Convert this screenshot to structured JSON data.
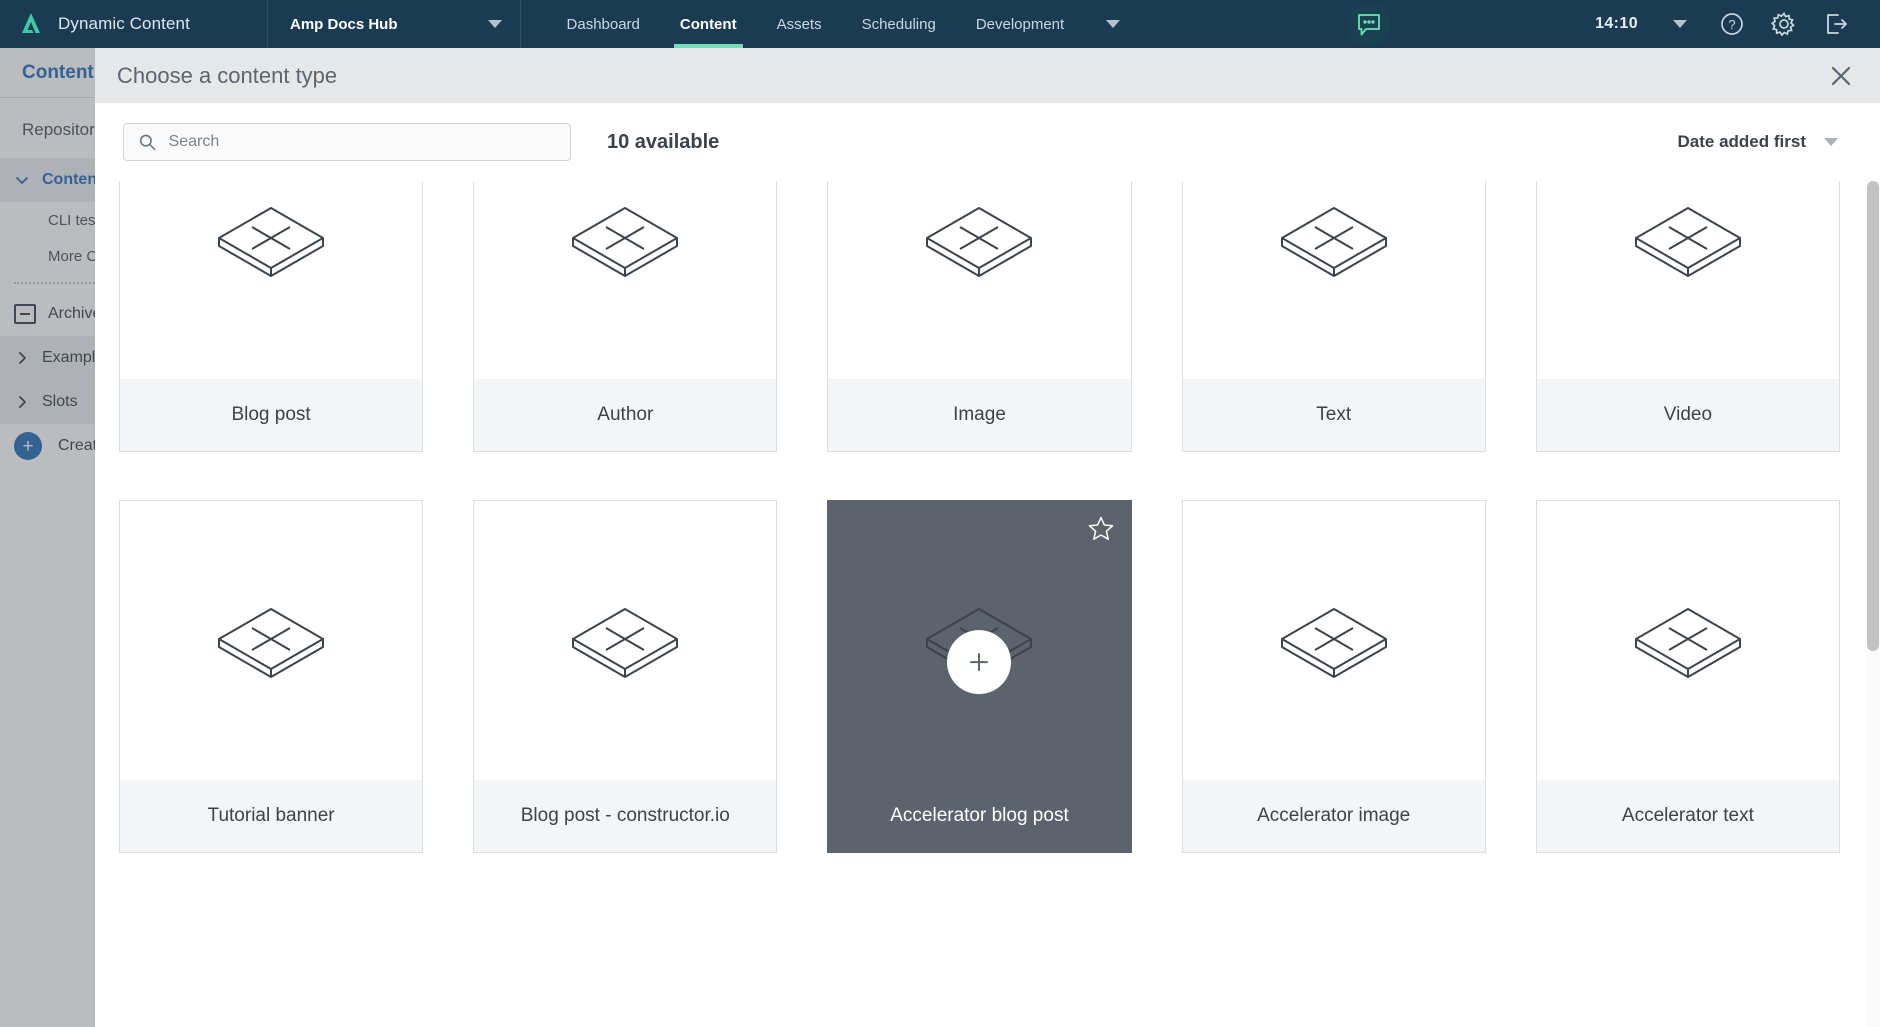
{
  "topnav": {
    "brand": "Dynamic Content",
    "brand_logo_icon": "amplience-logo-icon",
    "project": "Amp Docs Hub",
    "project_caret_icon": "chevron-down-icon",
    "tabs": [
      {
        "label": "Dashboard",
        "active": false
      },
      {
        "label": "Content",
        "active": true
      },
      {
        "label": "Assets",
        "active": false
      },
      {
        "label": "Scheduling",
        "active": false
      },
      {
        "label": "Development",
        "active": false
      }
    ],
    "overflow_caret_icon": "chevron-down-icon",
    "chat_icon": "chat-bubble-icon",
    "clock": "14:10",
    "clock_caret_icon": "chevron-down-icon",
    "help_icon": "help-circle-icon",
    "settings_icon": "gear-icon",
    "logout_icon": "sign-out-icon",
    "accent_color": "#6ee0b6",
    "bar_color": "#1b3b53"
  },
  "page_behind": {
    "header_title": "Content",
    "sidebar_label": "Repositories",
    "items": [
      {
        "label": "Content",
        "icon": "chevron-down-icon",
        "style": "link",
        "shaded": true
      },
      {
        "label": "CLI test",
        "style": "sub"
      },
      {
        "label": "More Content",
        "style": "sub"
      },
      {
        "label": "Archived",
        "icon": "archive-icon",
        "style": "plain",
        "shaded": false
      },
      {
        "label": "Examples",
        "icon": "chevron-right-icon",
        "style": "plain",
        "shaded": true
      },
      {
        "label": "Slots",
        "icon": "chevron-right-icon",
        "style": "plain",
        "shaded": true
      },
      {
        "label": "Create new",
        "icon": "plus-circle-icon",
        "style": "plain",
        "shaded": false
      }
    ]
  },
  "modal": {
    "title": "Choose a content type",
    "close_icon": "close-icon",
    "search": {
      "placeholder": "Search",
      "value": "",
      "icon": "search-icon"
    },
    "available_count": "10 available",
    "sort": {
      "label": "Date added first",
      "caret_icon": "chevron-down-icon"
    },
    "card_icon": "isometric-slab-icon",
    "selected_card_star_icon": "star-outline-icon",
    "selected_card_add_icon": "plus-icon",
    "selected_color": "#5c636c",
    "cards": [
      {
        "label": "Blog post",
        "selected": false
      },
      {
        "label": "Author",
        "selected": false
      },
      {
        "label": "Image",
        "selected": false
      },
      {
        "label": "Text",
        "selected": false
      },
      {
        "label": "Video",
        "selected": false
      },
      {
        "label": "Tutorial banner",
        "selected": false
      },
      {
        "label": "Blog post - constructor.io",
        "selected": false
      },
      {
        "label": "Accelerator blog post",
        "selected": true
      },
      {
        "label": "Accelerator image",
        "selected": false
      },
      {
        "label": "Accelerator text",
        "selected": false
      }
    ]
  }
}
